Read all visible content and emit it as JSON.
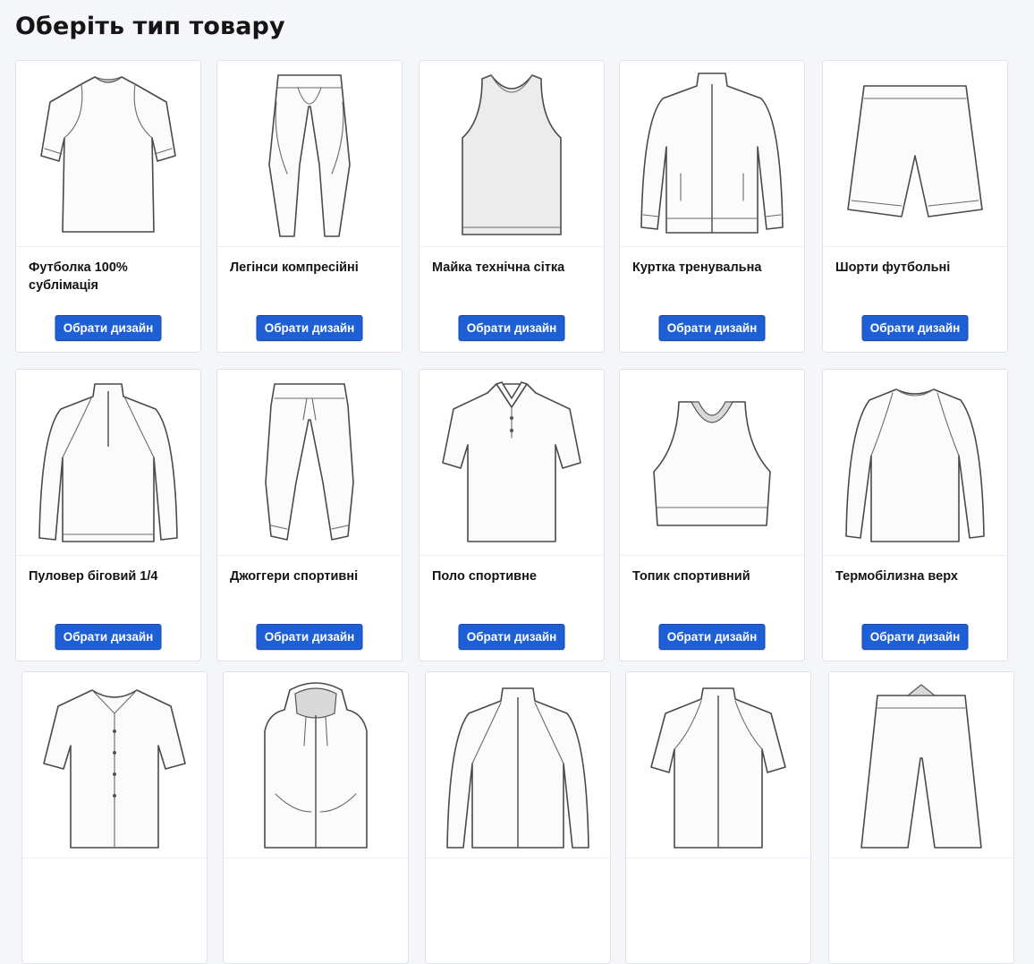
{
  "page": {
    "title": "Оберіть тип товару"
  },
  "products": [
    {
      "name": "Футболка 100% сублімація",
      "button": "Обрати дизайн",
      "icon": "tshirt-icon"
    },
    {
      "name": "Легінси компресійні",
      "button": "Обрати дизайн",
      "icon": "leggings-icon"
    },
    {
      "name": "Майка технічна сітка",
      "button": "Обрати дизайн",
      "icon": "mesh-tank-icon"
    },
    {
      "name": "Куртка тренувальна",
      "button": "Обрати дизайн",
      "icon": "track-jacket-icon"
    },
    {
      "name": "Шорти футбольні",
      "button": "Обрати дизайн",
      "icon": "shorts-icon"
    },
    {
      "name": "Пуловер біговий 1/4",
      "button": "Обрати дизайн",
      "icon": "quarter-zip-icon"
    },
    {
      "name": "Джоггери спортивні",
      "button": "Обрати дизайн",
      "icon": "joggers-icon"
    },
    {
      "name": "Поло спортивне",
      "button": "Обрати дизайн",
      "icon": "polo-icon"
    },
    {
      "name": "Топик спортивний",
      "button": "Обрати дизайн",
      "icon": "sports-bra-icon"
    },
    {
      "name": "Термобілизна верх",
      "button": "Обрати дизайн",
      "icon": "base-layer-top-icon"
    },
    {
      "name": "",
      "button": "",
      "icon": "baseball-jersey-icon"
    },
    {
      "name": "",
      "button": "",
      "icon": "zip-vest-hoodie-icon"
    },
    {
      "name": "",
      "button": "",
      "icon": "full-zip-jacket-icon"
    },
    {
      "name": "",
      "button": "",
      "icon": "zip-tee-icon"
    },
    {
      "name": "",
      "button": "",
      "icon": "long-shorts-icon"
    }
  ],
  "colors": {
    "background": "#f5f6fa",
    "button": "#1f5fd6",
    "button_text": "#ffffff"
  }
}
